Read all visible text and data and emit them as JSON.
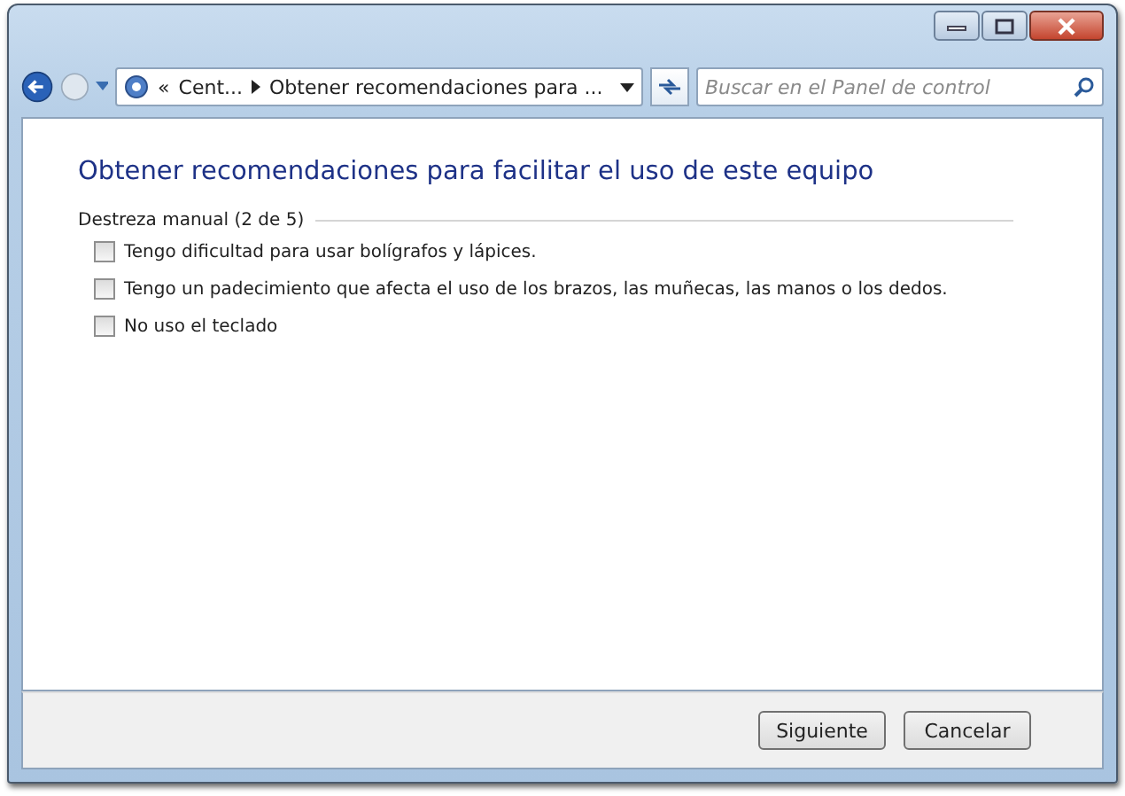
{
  "address_bar": {
    "overflow": "«",
    "crumbs": [
      "Cent...",
      "Obtener recomendaciones para ..."
    ]
  },
  "search": {
    "placeholder": "Buscar en el Panel de control"
  },
  "heading": "Obtener recomendaciones para facilitar el uso de este equipo",
  "group": {
    "title": "Destreza manual (2 de 5)",
    "options": [
      {
        "label": "Tengo dificultad para usar bolígrafos y lápices.",
        "checked": false
      },
      {
        "label": "Tengo un padecimiento que afecta el uso de los brazos, las muñecas, las manos o los dedos.",
        "checked": false
      },
      {
        "label": "No uso el teclado",
        "checked": false
      }
    ]
  },
  "buttons": [
    "Siguiente",
    "Cancelar"
  ]
}
